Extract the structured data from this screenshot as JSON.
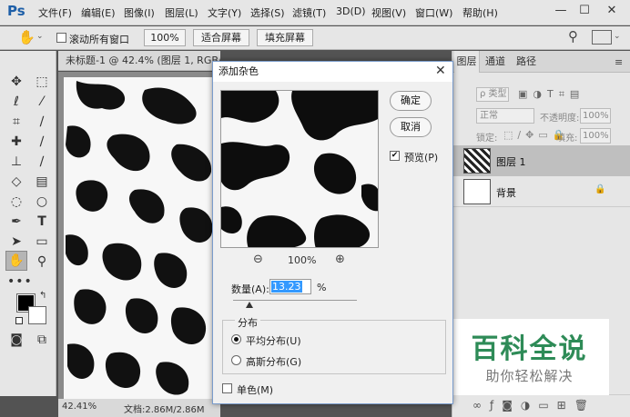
{
  "app": {
    "logo": "Ps",
    "menu": [
      "文件(F)",
      "编辑(E)",
      "图像(I)",
      "图层(L)",
      "文字(Y)",
      "选择(S)",
      "滤镜(T)",
      "3D(D)",
      "视图(V)",
      "窗口(W)",
      "帮助(H)"
    ],
    "window_controls": {
      "minimize": "—",
      "restore": "☐",
      "close": "✕"
    }
  },
  "options_bar": {
    "tool_icon": "hand-icon",
    "scroll_all_label": "滚动所有窗口",
    "btn_100": "100%",
    "btn_fit": "适合屏幕",
    "btn_fill": "填充屏幕"
  },
  "document": {
    "tab_title": "未标题-1 @ 42.4% (图层 1, RGB/8#",
    "zoom_status": "42.41%",
    "doc_status": "文档:2.86M/2.86M"
  },
  "layers_panel": {
    "tabs": [
      "图层",
      "通道",
      "路径"
    ],
    "filter_kind": "ρ 类型",
    "blend_mode": "正常",
    "opacity_label": "不透明度:",
    "opacity_value": "100%",
    "lock_label": "锁定:",
    "fill_label": "填充:",
    "fill_value": "100%",
    "layers": [
      {
        "name": "图层 1"
      },
      {
        "name": "背景"
      }
    ]
  },
  "dialog": {
    "title": "添加杂色",
    "ok": "确定",
    "cancel": "取消",
    "preview_label": "预览(P)",
    "zoom_value": "100%",
    "amount_label": "数量(A):",
    "amount_value": "13.23",
    "amount_unit": "%",
    "amount_level": 0.1323,
    "distribution_label": "分布",
    "uniform_label": "平均分布(U)",
    "gaussian_label": "高斯分布(G)",
    "mono_label": "单色(M)"
  },
  "watermark": {
    "title": "百科全说",
    "subtitle": "助你轻松解决"
  },
  "colors": {
    "brand_blue": "#1e5fa8",
    "watermark_green": "#2e8b57",
    "selection_blue": "#3399ff"
  }
}
